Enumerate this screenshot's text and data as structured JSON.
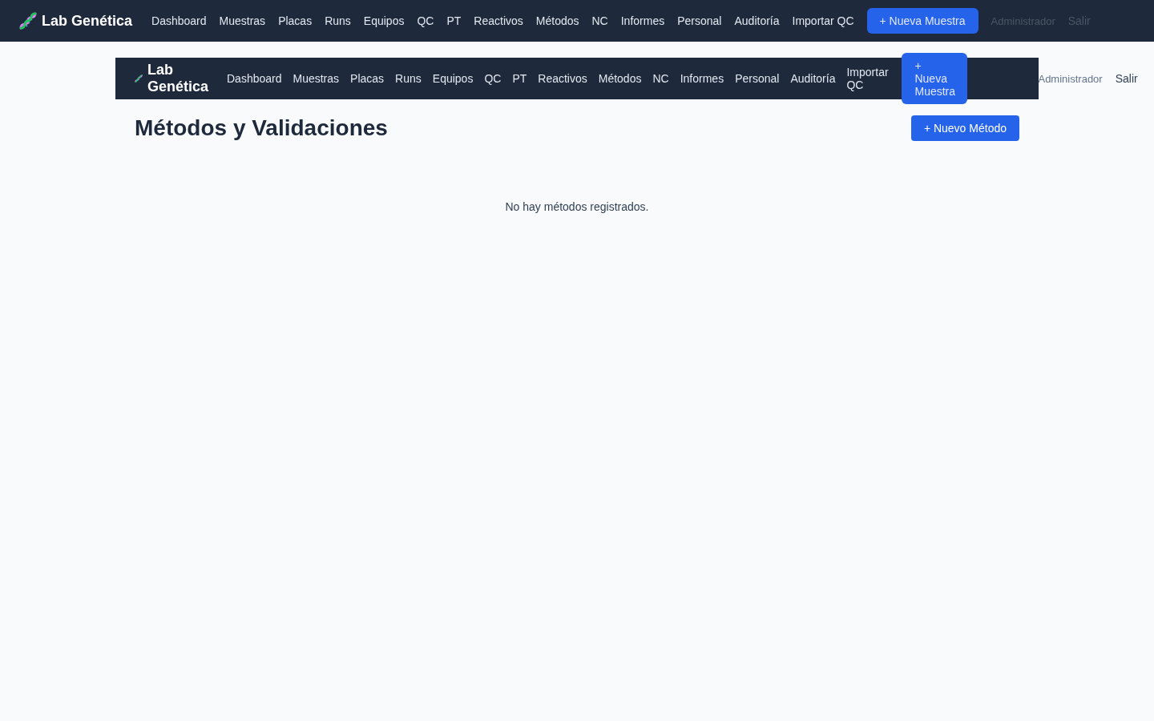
{
  "top_nav": {
    "brand": "Lab Genética",
    "links": [
      "Dashboard",
      "Muestras",
      "Placas",
      "Runs",
      "Equipos",
      "QC",
      "PT",
      "Reactivos",
      "Métodos",
      "NC",
      "Informes",
      "Personal",
      "Auditoría",
      "Importar QC"
    ],
    "action": "+ Nueva Muestra",
    "user": "Administrador",
    "logout": "Salir"
  },
  "page_nav": {
    "brand": "Lab Genética",
    "links": [
      "Dashboard",
      "Muestras",
      "Placas",
      "Runs",
      "Equipos",
      "QC",
      "PT",
      "Reactivos",
      "Métodos",
      "NC",
      "Informes",
      "Personal",
      "Auditoría",
      "Importar QC"
    ],
    "action": "+ Nueva Muestra",
    "user": "Administrador",
    "logout": "Salir"
  },
  "page": {
    "title": "Métodos y Validaciones",
    "action": "+ Nuevo Método",
    "empty_message": "No hay métodos registrados."
  }
}
